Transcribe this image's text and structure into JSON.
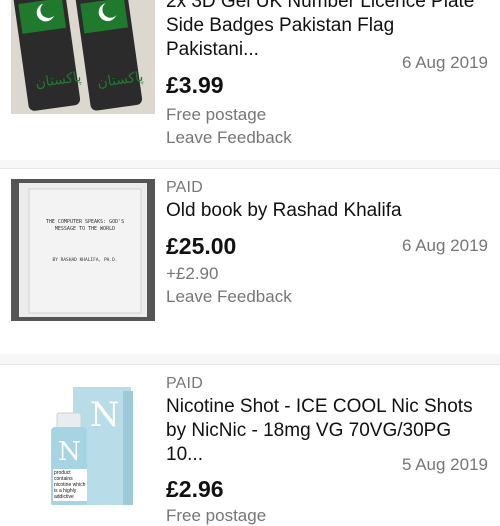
{
  "orders": [
    {
      "status": "",
      "title_line1": "2x 3D Gel UK Number Licence Plate",
      "title_line2": "Side Badges Pakistan Flag Pakistani...",
      "price": "£3.99",
      "date": "6 Aug 2019",
      "shipping": "Free postage",
      "action": "Leave Feedback"
    },
    {
      "status": "PAID",
      "title_line1": "Old book by Rashad Khalifa",
      "title_line2": "",
      "price": "£25.00",
      "date": "6 Aug 2019",
      "shipping": "+£2.90",
      "action": "Leave Feedback",
      "book_text": "THE COMPUTER SPEAKS: GOD'S MESSAGE TO THE WORLD",
      "book_author": "BY RASHAD KHALIFA, PH.D."
    },
    {
      "status": "PAID",
      "title_line1": "Nicotine Shot - ICE COOL Nic Shots",
      "title_line2": "by NicNic - 18mg VG 70VG/30PG 10...",
      "price": "£2.96",
      "date": "5 Aug 2019",
      "shipping": "Free postage",
      "action": "",
      "box_letter": "N",
      "bottle_letter": "N",
      "bottle_label": "product contains nicotine which is a highly addictive"
    }
  ],
  "colors": {
    "muted": "#767676",
    "title": "#111111",
    "badge_green": "#1d7a2b",
    "badge_dark": "#2a2a2a",
    "nic_blue": "#a9d3e0"
  }
}
